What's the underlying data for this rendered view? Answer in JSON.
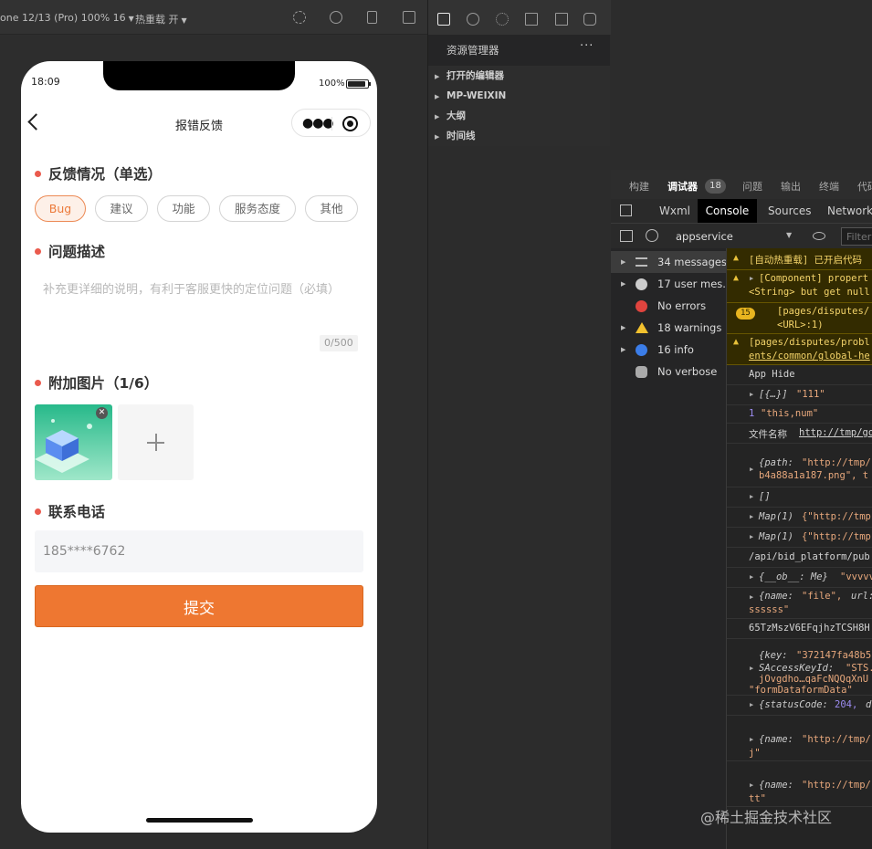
{
  "simulator": {
    "device": "one 12/13 (Pro) 100% 16",
    "hot_reload": "热重载 开"
  },
  "phone": {
    "status": {
      "time": "18:09",
      "battery": "100%"
    },
    "nav_title": "报错反馈",
    "sections": {
      "feedback_type": "反馈情况（单选）",
      "description": "问题描述",
      "images": "附加图片（1/6）",
      "phone": "联系电话"
    },
    "chips": [
      "Bug",
      "建议",
      "功能",
      "服务态度",
      "其他"
    ],
    "selected_chip": "Bug",
    "description_placeholder": "补充更详细的说明，有利于客服更快的定位问题（必填）",
    "char_counter": "0/500",
    "phone_value": "185****6762",
    "submit_label": "提交"
  },
  "explorer": {
    "title": "资源管理器",
    "more": "···",
    "items": [
      "打开的编辑器",
      "MP-WEIXIN",
      "大纲",
      "时间线"
    ]
  },
  "devtools": {
    "top_tabs": [
      "构建",
      "调试器",
      "问题",
      "输出",
      "终端",
      "代码"
    ],
    "debugger_badge": "18",
    "panel_tabs": [
      "Wxml",
      "Console",
      "Sources",
      "Network"
    ],
    "context": "appservice",
    "filter_placeholder": "Filter",
    "sidebar": [
      {
        "label": "34 messages",
        "icon": "list-icon"
      },
      {
        "label": "17 user mes...",
        "icon": "user-icon"
      },
      {
        "label": "No errors",
        "icon": "error-icon"
      },
      {
        "label": "18 warnings",
        "icon": "warning-icon"
      },
      {
        "label": "16 info",
        "icon": "info-icon"
      },
      {
        "label": "No verbose",
        "icon": "bug-icon"
      }
    ],
    "logs": {
      "l1": "[自动热重载] 已开启代码",
      "l2a": "[Component] propert",
      "l2b": "<String> but get null",
      "l3badge": "15",
      "l3a": "[pages/disputes/",
      "l3b": "<URL>:1)",
      "l4a": "[pages/disputes/probl",
      "l4b": "ents/common/global-he",
      "l5": "App Hide",
      "l6k": "[{…}]",
      "l6v": "\"111\"",
      "l7n": "1",
      "l7v": "\"this,num\"",
      "l8a": "文件名称",
      "l8b": "http://tmp/go",
      "l9k": "{path:",
      "l9v": "\"http://tmp/",
      "l9b": "b4a88a1a187.png\", t",
      "l10": "[]",
      "l11k": "Map(1)",
      "l11v": "{\"http://tmp",
      "l12k": "Map(1)",
      "l12v": "{\"http://tmp",
      "l13": "/api/bid_platform/pub",
      "l14k": "{__ob__: Me}",
      "l14v": "\"vvvvv",
      "l15k": "{name:",
      "l15v": "\"file\",",
      "l15u": "url:",
      "l15b": "ssssss\"",
      "l16": "65TzMszV6EFqjhzTCSH8H",
      "l17k": "{key:",
      "l17v": "\"372147fa48b5",
      "l17b": "SAccessKeyId:",
      "l17c": "\"STS.",
      "l17d": "jOvgdho…qaFcNQQqXnU",
      "l17e": "\"formDataformData\"",
      "l18k": "{statusCode:",
      "l18v": "204,",
      "l18d": "d",
      "l19k": "{name:",
      "l19v": "\"http://tmp/",
      "l19b": "j\"",
      "l20k": "{name:",
      "l20v": "\"http://tmp/",
      "l20b": "tt\""
    }
  },
  "watermark": "@稀土掘金技术社区",
  "colors": {
    "accent": "#ee7731",
    "chip_active_bg": "#fdf0e8",
    "section_dot": "#ea5a4d",
    "warning_bg": "#332b00"
  }
}
